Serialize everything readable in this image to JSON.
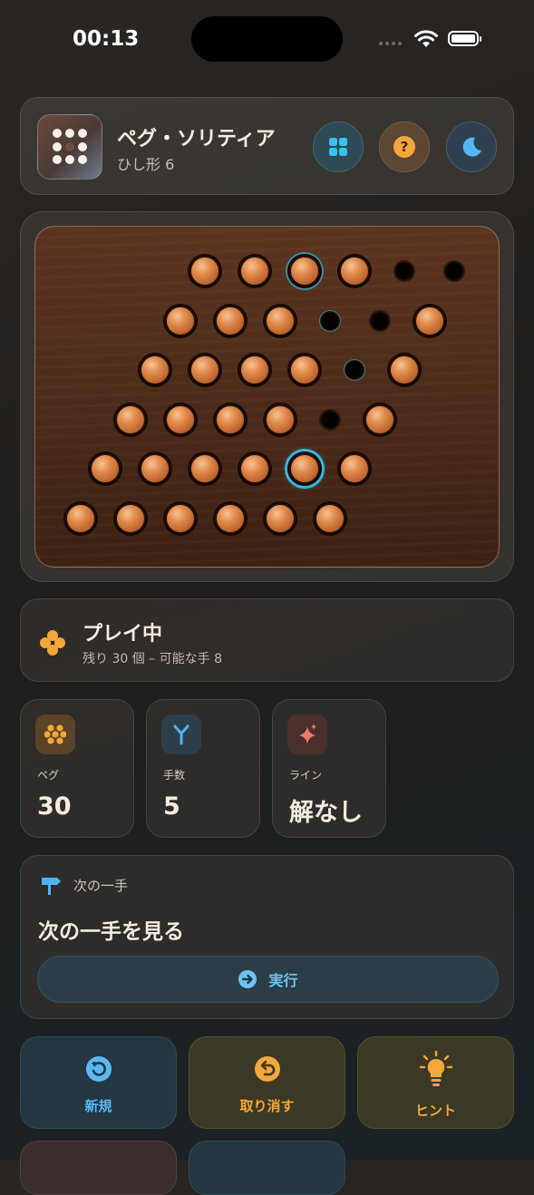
{
  "status_bar": {
    "time": "00:13"
  },
  "header": {
    "title": "ペグ・ソリティア",
    "subtitle": "ひし形 6",
    "buttons": [
      {
        "icon": "grid-icon",
        "color": "#39c2f0"
      },
      {
        "icon": "help-icon",
        "color": "#f4a73a"
      },
      {
        "icon": "moon-icon",
        "color": "#55b8f2"
      }
    ]
  },
  "board": {
    "rows": [
      [
        "peg",
        "peg",
        "peg-hl",
        "peg",
        "empty",
        "empty"
      ],
      [
        "peg",
        "peg",
        "peg",
        "empty-hl",
        "empty",
        "peg"
      ],
      [
        "peg",
        "peg",
        "peg",
        "peg",
        "empty-hl",
        "peg"
      ],
      [
        "peg",
        "peg",
        "peg",
        "peg",
        "empty",
        "peg"
      ],
      [
        "peg",
        "peg",
        "peg",
        "peg",
        "peg-sel",
        "peg"
      ],
      [
        "peg",
        "peg",
        "peg",
        "peg",
        "peg",
        "peg"
      ]
    ],
    "selected": [
      4,
      4
    ]
  },
  "game_status": {
    "title": "プレイ中",
    "subtitle": "残り 30 個 – 可能な手 8"
  },
  "stats": [
    {
      "label": "ペグ",
      "value": "30",
      "icon": "pegs-icon",
      "color": "#f4a73a"
    },
    {
      "label": "手数",
      "value": "5",
      "icon": "branch-icon",
      "color": "#4fb4ee"
    },
    {
      "label": "ライン",
      "value": "解なし",
      "icon": "sparkle-icon",
      "color": "#f07a6a"
    }
  ],
  "next_move": {
    "label": "次の一手",
    "title": "次の一手を見る",
    "execute_label": "実行"
  },
  "actions": [
    {
      "label": "新規",
      "icon": "new-game-icon",
      "color": "#5ab9f2"
    },
    {
      "label": "取り消す",
      "icon": "undo-icon",
      "color": "#f4a73a"
    },
    {
      "label": "ヒント",
      "icon": "lightbulb-icon",
      "color": "#f4a73a"
    }
  ]
}
